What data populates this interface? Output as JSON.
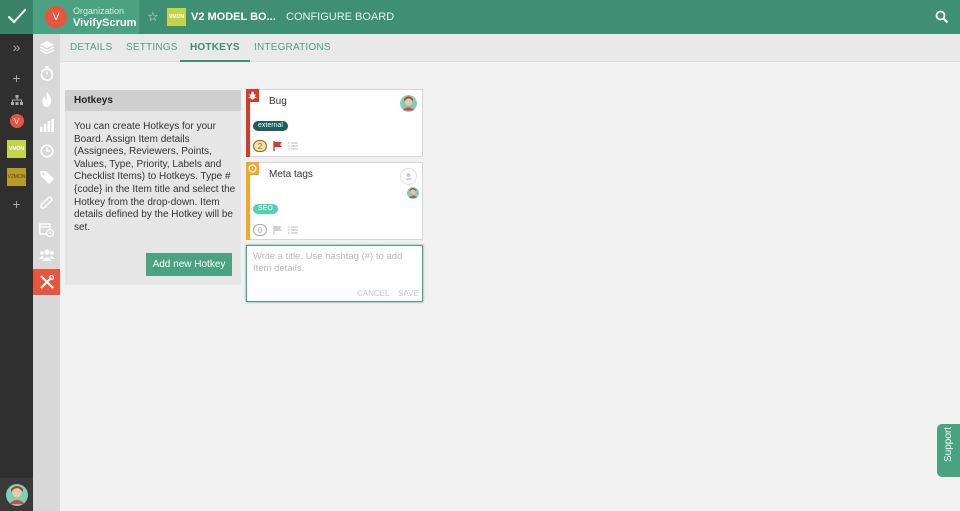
{
  "header": {
    "org_label": "Organization",
    "org_name": "VivifyScrum",
    "org_initial": "V",
    "board_thumb": "VMON",
    "board_name": "V2 MODEL BO...",
    "page_title": "CONFIGURE BOARD"
  },
  "sidebar": {
    "org_initial": "V",
    "board1_thumb": "VMON",
    "board2_thumb": "V2MON"
  },
  "tabs": [
    {
      "label": "DETAILS"
    },
    {
      "label": "SETTINGS"
    },
    {
      "label": "HOTKEYS"
    },
    {
      "label": "INTEGRATIONS"
    }
  ],
  "hotkeys_panel": {
    "title": "Hotkeys",
    "description": "You can create Hotkeys for your Board. Assign Item details (Assignees, Reviewers, Points, Values, Type, Priority, Labels and Checklist Items) to Hotkeys. Type #{code} in the Item title and select the Hotkey from the drop-down. Item details defined by the Hotkey will be set.",
    "add_button": "Add new Hotkey"
  },
  "cards": [
    {
      "title": "Bug",
      "label": "external",
      "points": "2",
      "type": "bug"
    },
    {
      "title": "Meta tags",
      "label": "SEO",
      "points": "0",
      "type": "feature"
    }
  ],
  "new_card": {
    "placeholder": "Write a title. Use hashtag (#) to add Item details.",
    "cancel": "CANCEL",
    "save": "SAVE"
  },
  "support": "Support",
  "colors": {
    "brand_green": "#3f8f74",
    "accent_orange": "#e8553e",
    "bug_red": "#d9382b",
    "feature_orange": "#f5a623",
    "label_dark_teal": "#1f5d5a",
    "label_teal": "#4fd3b2"
  }
}
